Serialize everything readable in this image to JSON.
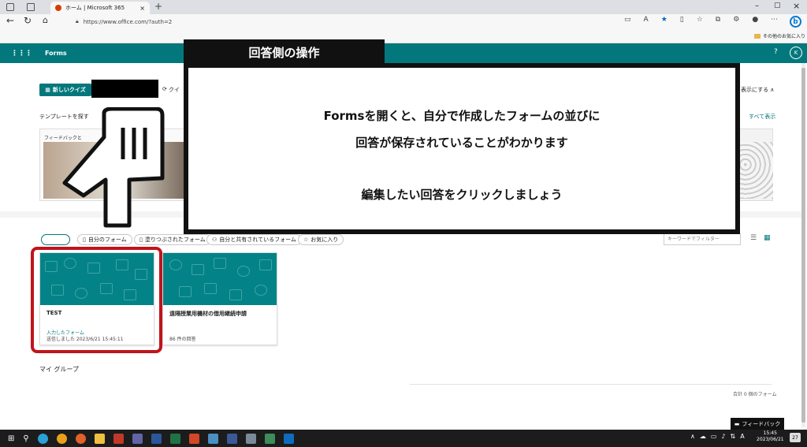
{
  "browser": {
    "tab_title": "ホーム | Microsoft 365",
    "url": "https://www.office.com/?auth=2",
    "favorites_label": "その他のお気に入り"
  },
  "forms_header": {
    "app_name": "Forms",
    "help": "?",
    "avatar": "K"
  },
  "toolbar": {
    "new_quiz_label": "新しいクイズ",
    "quiz_partial": "クイ",
    "show_label": "表示にする ∧"
  },
  "templates": {
    "heading": "テンプレートを探す",
    "show_all": "すべて表示",
    "first_label": "フィードバックと"
  },
  "filters": {
    "recent": "最近",
    "my_forms": "自分のフォーム",
    "filled": "塗りつぶされたフォーム",
    "shared": "自分と共有されているフォーム",
    "favorites": "お気に入り",
    "search_placeholder": "キーワードでフィルター"
  },
  "cards": [
    {
      "title": "TEST",
      "line1": "入力したフォーム",
      "line2": "送信しました 2023/6/21 15:45:11"
    },
    {
      "title": "遠隔授業用機材の借用継続申請",
      "line1": "",
      "line2": "86 件の回答"
    }
  ],
  "groups": {
    "heading": "マイ グループ",
    "total": "合計 0 個のフォーム"
  },
  "feedback_button": "フィードバック",
  "callout": {
    "title": "回答側の操作",
    "line1": "Formsを開くと、自分で作成したフォームの並びに",
    "line2": "回答が保存されていることがわかります",
    "line3": "編集したい回答をクリックしましょう"
  },
  "taskbar": {
    "time": "15:45",
    "date": "2023/06/21",
    "notifications": "27",
    "lang": "A"
  },
  "colors": {
    "forms_teal": "#03787c",
    "highlight_red": "#c0141c"
  }
}
